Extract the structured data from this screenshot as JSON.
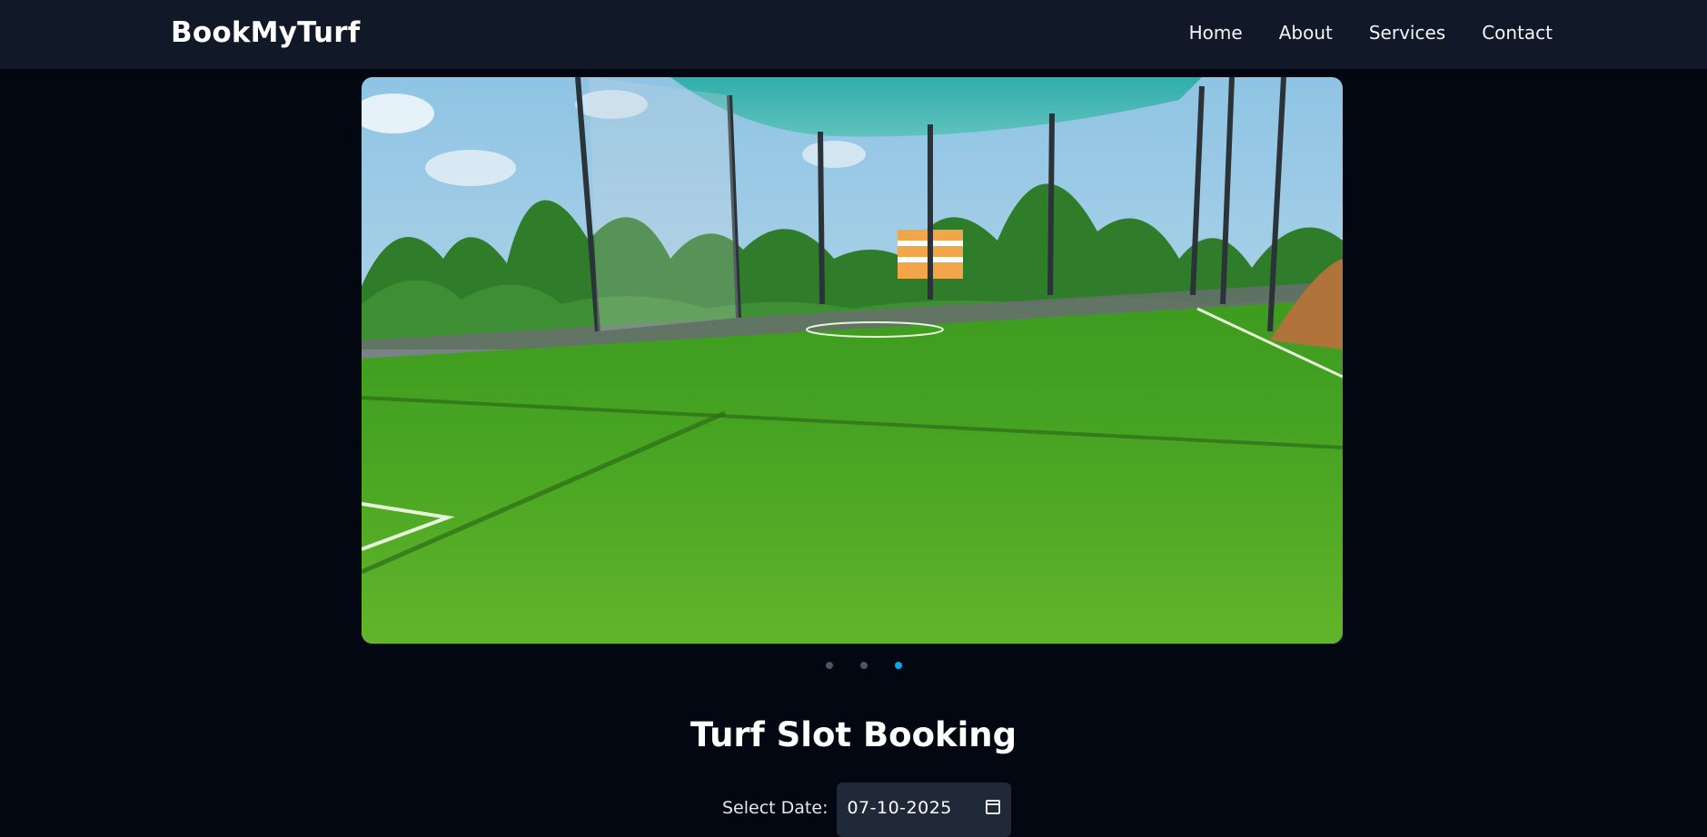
{
  "navbar": {
    "brand": "BookMyTurf",
    "links": [
      "Home",
      "About",
      "Services",
      "Contact"
    ]
  },
  "carousel": {
    "slide_count": 3,
    "active_index": 2,
    "image": "artificial turf football ground with netting",
    "colors": {
      "dot_active": "#0ea5e9",
      "dot_inactive": "#4b5563"
    }
  },
  "booking": {
    "title": "Turf Slot Booking",
    "date_label": "Select Date:",
    "date_value": "07-10-2025",
    "calendar_icon": "calendar-icon"
  },
  "theme": {
    "background": "#030712",
    "navbar": "#111827",
    "input_bg": "#1f2937"
  }
}
